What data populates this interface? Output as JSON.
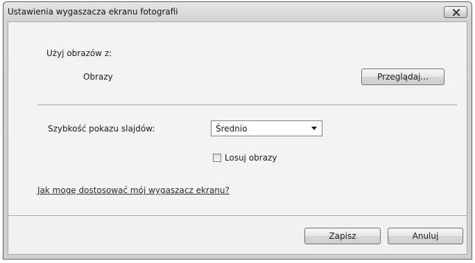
{
  "window": {
    "title": "Ustawienia wygaszacza ekranu fotografii"
  },
  "source": {
    "label": "Użyj obrazów z:",
    "folder": "Obrazy",
    "browse_label": "Przeglądaj..."
  },
  "speed": {
    "label": "Szybkość pokazu slajdów:",
    "selected": "Średnio"
  },
  "shuffle": {
    "label": "Losuj obrazy",
    "checked": false
  },
  "help_link": "Jak mogę dostosować mój wygaszacz ekranu?",
  "footer": {
    "save_label": "Zapisz",
    "cancel_label": "Anuluj"
  }
}
